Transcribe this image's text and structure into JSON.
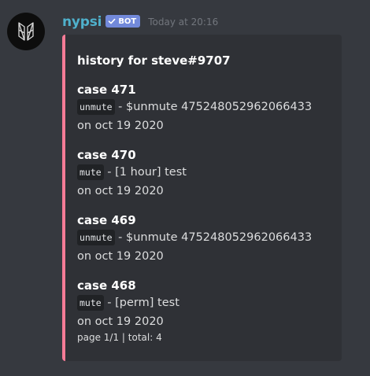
{
  "author": {
    "name": "nypsi",
    "bot_tag": "BOT",
    "timestamp": "Today at 20:16",
    "avatar_icon": "nypsi-logo-icon"
  },
  "colors": {
    "embed_accent": "#f47b96",
    "username": "#4fb1cc",
    "bot_tag_bg": "#7289da",
    "background": "#36393f",
    "embed_bg": "#2f3136"
  },
  "embed": {
    "title": "history for steve#9707",
    "cases": [
      {
        "name": "case 471",
        "command": "unmute",
        "detail": " - $unmute 475248052962066433",
        "date": "on oct 19 2020"
      },
      {
        "name": "case 470",
        "command": "mute",
        "detail": " - [1 hour] test",
        "date": "on oct 19 2020"
      },
      {
        "name": "case 469",
        "command": "unmute",
        "detail": " - $unmute 475248052962066433",
        "date": "on oct 19 2020"
      },
      {
        "name": "case 468",
        "command": "mute",
        "detail": " - [perm] test",
        "date": "on oct 19 2020"
      }
    ],
    "footer": "page 1/1 | total: 4"
  }
}
